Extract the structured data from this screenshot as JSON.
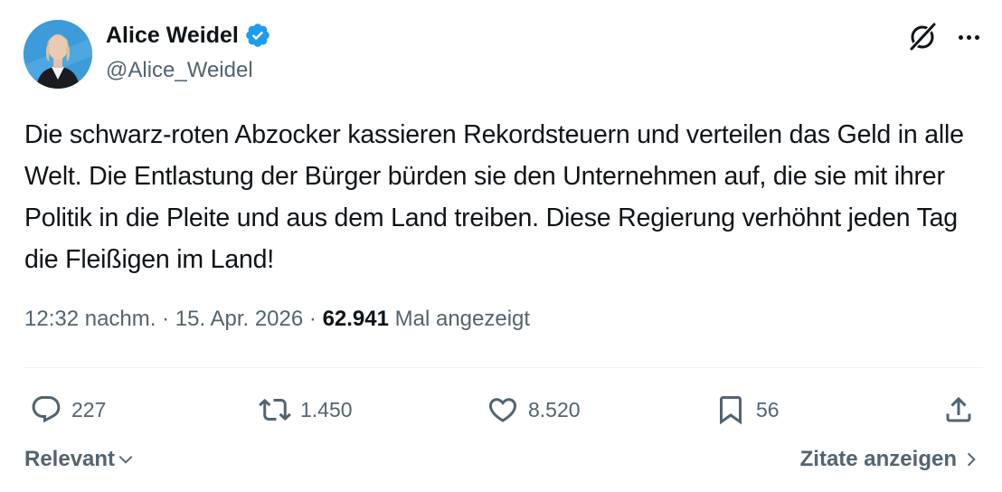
{
  "author": {
    "name": "Alice Weidel",
    "handle": "@Alice_Weidel",
    "avatar_icon": "profile-photo",
    "verified_icon": "verified-badge-icon",
    "verified_color": "#1d9bf0"
  },
  "tweet": {
    "text": "Die schwarz-roten Abzocker kassieren Rekordsteuern und verteilen das Geld in alle Welt. Die Entlastung der Bürger bürden sie den Unternehmen auf, die sie mit ihrer Politik in die Pleite und aus dem Land treiben. Diese Regierung verhöhnt jeden Tag die Fleißigen im Land!"
  },
  "meta": {
    "time": "12:32 nachm.",
    "separator": " · ",
    "date": "15. Apr. 2026",
    "views_count": "62.941",
    "views_label": "Mal angezeigt"
  },
  "actions": {
    "replies": "227",
    "reposts": "1.450",
    "likes": "8.520",
    "bookmarks": "56"
  },
  "footer": {
    "sort_label": "Relevant",
    "quotes_label": "Zitate anzeigen"
  },
  "colors": {
    "text_primary": "#0f1419",
    "text_secondary": "#536471",
    "divider": "#eff3f4",
    "accent": "#1d9bf0"
  }
}
